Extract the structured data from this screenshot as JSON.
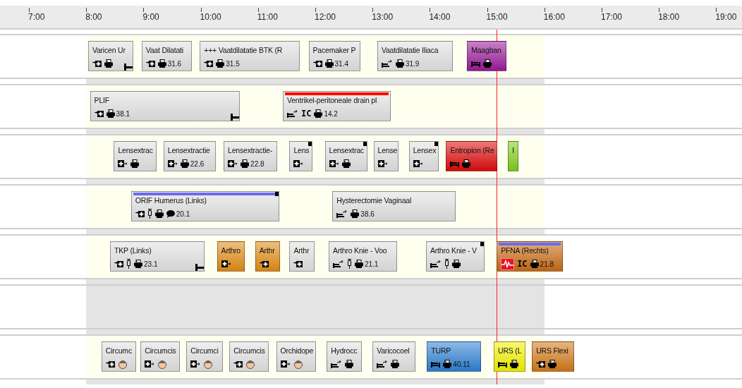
{
  "axis": {
    "ticks": [
      "7:00",
      "8:00",
      "9:00",
      "10:00",
      "11:00",
      "12:00",
      "13:00",
      "14:00",
      "15:00",
      "16:00",
      "17:00",
      "18:00",
      "19:00"
    ]
  },
  "lanes": [
    {
      "open": true,
      "cards": [
        {
          "title": "Varicen Ur",
          "color": "#e0e0e0",
          "icons": [
            {
              "kind": "admit"
            },
            {
              "kind": "printer"
            }
          ],
          "end_marker": true
        },
        {
          "title": "Vaat Dilatati",
          "color": "#e0e0e0",
          "icons": [
            {
              "kind": "admit"
            },
            {
              "kind": "printer"
            }
          ],
          "value": "31.6"
        },
        {
          "title": "+++ Vaatdilatatie BTK (R",
          "color": "#e0e0e0",
          "icons": [
            {
              "kind": "admit"
            },
            {
              "kind": "printer"
            }
          ],
          "value": "31.5"
        },
        {
          "title": "Pacemaker P",
          "color": "#e0e0e0",
          "icons": [
            {
              "kind": "admit"
            },
            {
              "kind": "printer"
            }
          ],
          "value": "31.4"
        },
        {
          "title": "Vaatdilatatie Iliaca",
          "color": "#e0e0e0",
          "icons": [
            {
              "kind": "bed-transfer"
            },
            {
              "kind": "printer"
            }
          ],
          "value": "31.9"
        },
        {
          "title": "Maagban",
          "color": "#9a1a9a",
          "icons": [
            {
              "kind": "bed"
            },
            {
              "kind": "printer"
            }
          ]
        }
      ]
    },
    {
      "open": true,
      "cards": [
        {
          "title": "PLIF",
          "color": "#e0e0e0",
          "icons": [
            {
              "kind": "admit"
            },
            {
              "kind": "printer"
            }
          ],
          "value": "38.1",
          "end_marker": true
        },
        {
          "title": "Ventrikel-peritoneale drain pl",
          "color": "#e0e0e0",
          "top_bar": {
            "kind": "alert"
          },
          "icons": [
            {
              "kind": "bed-transfer"
            },
            {
              "kind": "text",
              "text": "IC"
            },
            {
              "kind": "printer"
            }
          ],
          "value": "14.2"
        }
      ]
    },
    {
      "open": true,
      "cards": [
        {
          "title": "Lensextrac",
          "color": "#e0e0e0",
          "icons": [
            {
              "kind": "discharge"
            },
            {
              "kind": "printer"
            }
          ]
        },
        {
          "title": "Lensextractie",
          "color": "#e0e0e0",
          "icons": [
            {
              "kind": "discharge"
            },
            {
              "kind": "printer"
            }
          ],
          "value": "22.6"
        },
        {
          "title": "Lensextractie-",
          "color": "#e0e0e0",
          "icons": [
            {
              "kind": "discharge"
            },
            {
              "kind": "printer"
            }
          ],
          "value": "22.8"
        },
        {
          "title": "Lens",
          "color": "#e0e0e0",
          "corner_mark": true,
          "icons": [
            {
              "kind": "discharge"
            }
          ]
        },
        {
          "title": "Lensextrac",
          "color": "#e0e0e0",
          "corner_mark": true,
          "icons": [
            {
              "kind": "discharge"
            },
            {
              "kind": "printer"
            }
          ]
        },
        {
          "title": "Lense",
          "color": "#e0e0e0",
          "icons": [
            {
              "kind": "discharge"
            }
          ]
        },
        {
          "title": "Lensex",
          "color": "#e0e0e0",
          "corner_mark": true,
          "icons": [
            {
              "kind": "discharge"
            }
          ]
        },
        {
          "title": "Entropion (Re",
          "color": "#dd0a0a",
          "icons": [
            {
              "kind": "bed"
            },
            {
              "kind": "printer"
            }
          ]
        },
        {
          "title": "I",
          "color": "#80cc1a"
        }
      ]
    },
    {
      "open": true,
      "cards": [
        {
          "title": "ORIF Humerus (Links)",
          "color": "#e0e0e0",
          "top_bar": {
            "kind": "info"
          },
          "corner_mark": true,
          "icons": [
            {
              "kind": "admit"
            },
            {
              "kind": "syringe"
            },
            {
              "kind": "printer"
            },
            {
              "kind": "speech"
            }
          ],
          "value": "20.1"
        },
        {
          "title": "Hysterectomie Vaginaal",
          "color": "#e0e0e0",
          "icons": [
            {
              "kind": "bed-transfer"
            },
            {
              "kind": "printer"
            }
          ],
          "value": "38.6"
        }
      ]
    },
    {
      "open": true,
      "cards": [
        {
          "title": "TKP (Links)",
          "color": "#e0e0e0",
          "icons": [
            {
              "kind": "admit"
            },
            {
              "kind": "syringe"
            },
            {
              "kind": "printer"
            }
          ],
          "value": "23.1",
          "end_marker": true
        },
        {
          "title": "Arthro",
          "color": "#e08a12",
          "icons": [
            {
              "kind": "discharge"
            }
          ]
        },
        {
          "title": "Arthr",
          "color": "#e08a12",
          "icons": [
            {
              "kind": "admit"
            }
          ]
        },
        {
          "title": "Arthr",
          "color": "#e0e0e0",
          "icons": [
            {
              "kind": "admit"
            }
          ]
        },
        {
          "title": "Arthro Knie - Voo",
          "color": "#e0e0e0",
          "icons": [
            {
              "kind": "bed-transfer"
            },
            {
              "kind": "syringe"
            },
            {
              "kind": "printer"
            }
          ],
          "value": "21.1"
        },
        {
          "title": "Arthro Knie - V",
          "color": "#e0e0e0",
          "corner_mark": true,
          "icons": [
            {
              "kind": "bed-transfer"
            },
            {
              "kind": "syringe"
            },
            {
              "kind": "printer"
            }
          ]
        },
        {
          "title": "PFNA (Rechts)",
          "color": "#c86a14",
          "top_bar": {
            "kind": "info"
          },
          "icons": [
            {
              "kind": "monitor"
            },
            {
              "kind": "text",
              "text": "IC"
            },
            {
              "kind": "printer"
            }
          ],
          "value": "21.8"
        }
      ]
    },
    {
      "open": false
    },
    {
      "open": true,
      "cards": [
        {
          "title": "Circumc",
          "color": "#e0e0e0",
          "icons": [
            {
              "kind": "admit"
            },
            {
              "kind": "head"
            }
          ]
        },
        {
          "title": "Circumcis",
          "color": "#e0e0e0",
          "icons": [
            {
              "kind": "discharge"
            },
            {
              "kind": "head"
            }
          ]
        },
        {
          "title": "Circumci",
          "color": "#e0e0e0",
          "icons": [
            {
              "kind": "discharge"
            },
            {
              "kind": "head"
            }
          ]
        },
        {
          "title": "Circumcis",
          "color": "#e0e0e0",
          "icons": [
            {
              "kind": "admit"
            },
            {
              "kind": "head"
            }
          ]
        },
        {
          "title": "Orchidope",
          "color": "#e0e0e0",
          "icons": [
            {
              "kind": "discharge"
            },
            {
              "kind": "head"
            }
          ]
        },
        {
          "title": "Hydrocc",
          "color": "#e0e0e0",
          "icons": [
            {
              "kind": "bed-transfer"
            },
            {
              "kind": "printer"
            }
          ]
        },
        {
          "title": "Varicocoel",
          "color": "#e0e0e0",
          "icons": [
            {
              "kind": "bed-transfer"
            },
            {
              "kind": "printer"
            }
          ]
        },
        {
          "title": "TURP",
          "color": "#2d7fd2",
          "icons": [
            {
              "kind": "bed"
            },
            {
              "kind": "printer"
            }
          ],
          "value": "40.11"
        },
        {
          "title": "URS (L",
          "color": "#f0f000",
          "icons": [
            {
              "kind": "bed"
            },
            {
              "kind": "printer"
            }
          ]
        },
        {
          "title": "URS Flexi",
          "color": "#d27818",
          "icons": [
            {
              "kind": "admit"
            },
            {
              "kind": "printer"
            }
          ]
        }
      ]
    }
  ]
}
